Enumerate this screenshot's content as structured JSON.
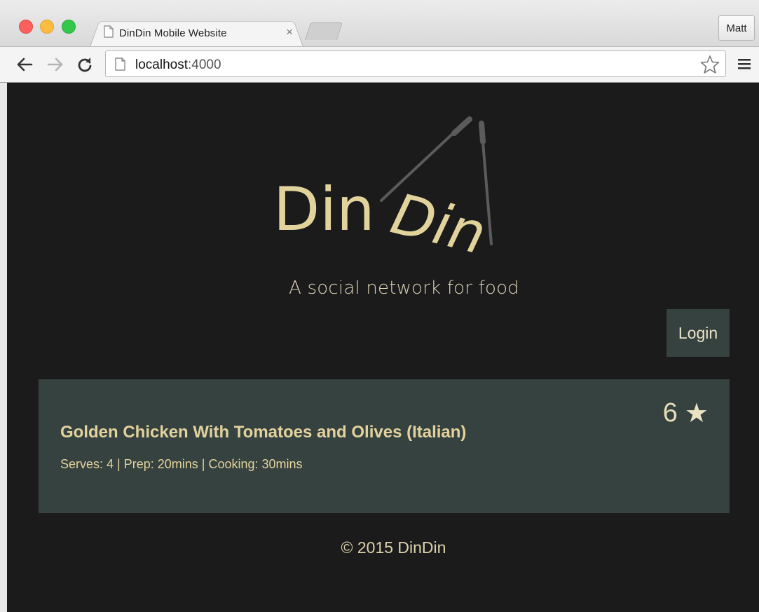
{
  "browser": {
    "tab_title": "DinDin Mobile Website",
    "tab_close": "×",
    "profile_name": "Matt",
    "address_host": "localhost",
    "address_port": ":4000"
  },
  "icons": {
    "back": "back-arrow-icon",
    "forward": "forward-arrow-icon",
    "reload": "reload-icon",
    "page": "page-icon",
    "bookmark": "star-outline-icon",
    "menu": "hamburger-menu-icon"
  },
  "logo": {
    "word_left": "Din",
    "word_right": "Din"
  },
  "header": {
    "tagline": "A social network for food",
    "login_label": "Login"
  },
  "recipes": [
    {
      "title": "Golden Chicken With Tomatoes and Olives (Italian)",
      "meta": "Serves: 4 | Prep: 20mins | Cooking: 30mins",
      "rating": "6",
      "rating_symbol": "★"
    }
  ],
  "footer": {
    "copyright": "© 2015 DinDin"
  },
  "colors": {
    "page_bg": "#1b1b1c",
    "card_bg": "#354240",
    "accent_text": "#e3d29c"
  }
}
